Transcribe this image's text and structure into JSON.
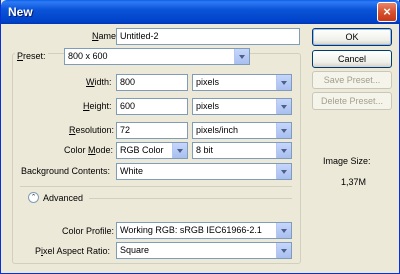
{
  "window": {
    "title": "New",
    "close_glyph": "×"
  },
  "form": {
    "name": {
      "label_key": "N",
      "label_rest": "ame:",
      "value": "Untitled-2"
    },
    "preset": {
      "label_key": "P",
      "label_rest": "reset:",
      "value": "800 x 600"
    },
    "width": {
      "label_key": "W",
      "label_rest": "idth:",
      "value": "800",
      "unit": "pixels"
    },
    "height": {
      "label_key": "H",
      "label_rest": "eight:",
      "value": "600",
      "unit": "pixels"
    },
    "resolution": {
      "label_key": "R",
      "label_rest": "esolution:",
      "value": "72",
      "unit": "pixels/inch"
    },
    "color_mode": {
      "label_pre": "Color ",
      "label_key": "M",
      "label_rest": "ode:",
      "value": "RGB Color",
      "depth": "8 bit"
    },
    "background": {
      "label": "Background Contents:",
      "value": "White"
    },
    "advanced": {
      "label": "Advanced",
      "icon_glyph": "⌃"
    },
    "color_profile": {
      "label": "Color Profile:",
      "value": "Working RGB:  sRGB IEC61966-2.1"
    },
    "pixel_aspect": {
      "label_pre": "P",
      "label_key": "i",
      "label_rest": "xel Aspect Ratio:",
      "value": "Square"
    }
  },
  "buttons": {
    "ok": "OK",
    "cancel": "Cancel",
    "save_preset": "Save Preset...",
    "delete_preset": "Delete Preset..."
  },
  "image_size": {
    "label": "Image Size:",
    "value": "1,37M"
  }
}
